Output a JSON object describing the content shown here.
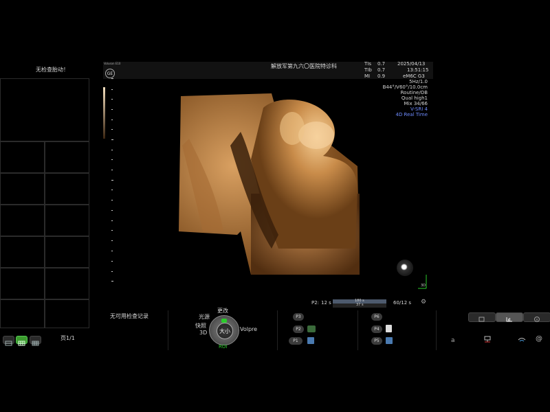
{
  "left_panel": {
    "no_heartbeat": "无检查胎动！",
    "page_label": "页1/1",
    "no_records": "无可用检查记录"
  },
  "header": {
    "logo": "GE",
    "logo_sub": "Voluson E10",
    "hospital": "解放军第九六〇医院特诊科",
    "indices": [
      {
        "label": "TIs",
        "value": "0.7"
      },
      {
        "label": "TIb",
        "value": "0.7"
      },
      {
        "label": "MI",
        "value": "0.9"
      }
    ],
    "date": "2025/04/13",
    "time": "13:51:15"
  },
  "info": {
    "lines": [
      "5Hz/1.0",
      "B44°/V60°/10.0cm",
      "Routine/OB",
      "Qual high1",
      "Mix 34/66"
    ],
    "vsri": "V-SRI 4",
    "mode": "4D Real Time",
    "probe": "eM6C G3"
  },
  "cine": {
    "left_label": "P2:",
    "left_value": "12 s",
    "bar_top": "180 s",
    "bar_bottom": "37 s",
    "right_value": "60/12 s"
  },
  "render_label": "3D",
  "controls": {
    "dial_center": "大小",
    "top_label": "更改",
    "left_upper": "光源",
    "left_mid": "快照",
    "left_lower": "3D",
    "right_label": "Volpre",
    "bottom_label": "ROI"
  },
  "preset_group1": [
    "P3",
    "P2",
    "P1"
  ],
  "preset_group2": [
    "P6",
    "P4",
    "P5"
  ],
  "right_tools": {
    "letter": "a"
  },
  "colors": {
    "accent_green": "#2bcc2b",
    "info_blue": "#6f8cff",
    "image_tone": "#c98c4a"
  }
}
